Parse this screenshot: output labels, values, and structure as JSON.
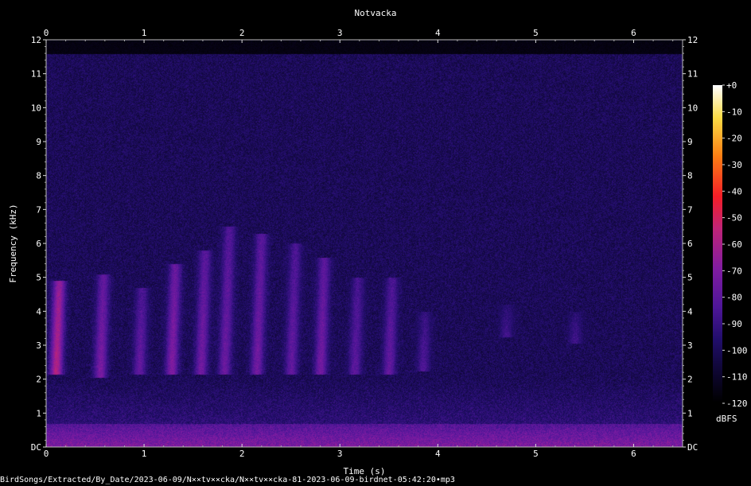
{
  "chart_data": {
    "type": "heatmap",
    "title": "Notvacka",
    "xlabel": "Time (s)",
    "ylabel": "Frequency (kHz)",
    "xlim": [
      0,
      6.5
    ],
    "ylim": [
      0,
      12
    ],
    "x_ticks": [
      "0",
      "1",
      "2",
      "3",
      "4",
      "5",
      "6"
    ],
    "y_ticks": [
      "DC",
      "1",
      "2",
      "3",
      "4",
      "5",
      "6",
      "7",
      "8",
      "9",
      "10",
      "11",
      "12"
    ],
    "colorbar": {
      "label": "dBFS",
      "range": [
        -120,
        0
      ],
      "ticks": [
        "+0",
        "-10",
        "-20",
        "-30",
        "-40",
        "-50",
        "-60",
        "-70",
        "-80",
        "-90",
        "-100",
        "-110",
        "-120"
      ]
    },
    "calls": [
      {
        "t": 0.1,
        "f_low": 2.3,
        "f_high": 4.9,
        "db": -58
      },
      {
        "t": 0.55,
        "f_low": 2.2,
        "f_high": 5.1,
        "db": -72
      },
      {
        "t": 0.95,
        "f_low": 2.3,
        "f_high": 4.7,
        "db": -78
      },
      {
        "t": 1.28,
        "f_low": 2.3,
        "f_high": 5.4,
        "db": -70
      },
      {
        "t": 1.58,
        "f_low": 2.3,
        "f_high": 5.8,
        "db": -74
      },
      {
        "t": 1.82,
        "f_low": 2.3,
        "f_high": 6.5,
        "db": -76
      },
      {
        "t": 2.15,
        "f_low": 2.3,
        "f_high": 6.3,
        "db": -74
      },
      {
        "t": 2.5,
        "f_low": 2.3,
        "f_high": 6.0,
        "db": -78
      },
      {
        "t": 2.8,
        "f_low": 2.3,
        "f_high": 5.6,
        "db": -74
      },
      {
        "t": 3.15,
        "f_low": 2.3,
        "f_high": 5.0,
        "db": -80
      },
      {
        "t": 3.5,
        "f_low": 2.3,
        "f_high": 5.0,
        "db": -78
      },
      {
        "t": 3.85,
        "f_low": 2.4,
        "f_high": 4.0,
        "db": -84
      },
      {
        "t": 4.7,
        "f_low": 3.4,
        "f_high": 4.2,
        "db": -88
      },
      {
        "t": 5.4,
        "f_low": 3.2,
        "f_high": 4.0,
        "db": -88
      }
    ],
    "low_band": {
      "f_low": 0,
      "f_high": 0.7,
      "db": -70
    },
    "noise_floor_db": -100,
    "upper_cutoff_khz": 11.6
  },
  "caption": "BirdSongs/Extracted/By_Date/2023-06-09/N××tv××cka/N××tv××cka-81-2023-06-09-birdnet-05:42:20•mp3",
  "colors": {
    "background": "#000000",
    "text": "#ffffff"
  }
}
